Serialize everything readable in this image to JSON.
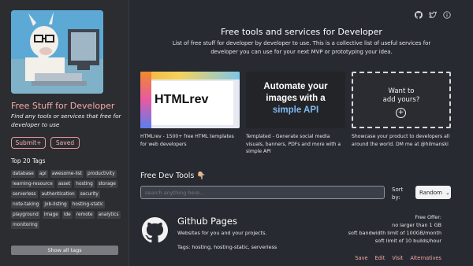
{
  "sidebar": {
    "title": "Free Stuff for Developer",
    "description": "Find any tools or services that free for developer to use",
    "submit_label": "Submit+",
    "saved_label": "Saved",
    "tags_heading": "Top 20 Tags",
    "tags": [
      "database",
      "api",
      "awesome-list",
      "productivity",
      "learning-resource",
      "asset",
      "hosting",
      "storage",
      "serverless",
      "authentication",
      "security",
      "note-taking",
      "job-listing",
      "hosting-static",
      "playground",
      "image",
      "ide",
      "remote",
      "analytics",
      "monitoring"
    ],
    "show_all_label": "Show all tags"
  },
  "header": {
    "icons": [
      "github-icon",
      "twitter-icon",
      "info-icon"
    ],
    "headline": "Free tools and services for Developer",
    "subline": "List of free stuff for developer by developer to use. This is a collective list of useful services for developer you can use for your next MVP or prototyping your idea."
  },
  "featured": [
    {
      "image_text": "HTMLrev",
      "text": "HTMLrev - 1500+ free HTML templates for web developers"
    },
    {
      "image_lines": [
        "Automate your",
        "images with a",
        "simple API"
      ],
      "text": "Templated - Generate social media visuals, banners, PDFs and more with a simple API"
    },
    {
      "image_lines": [
        "Want to",
        "add yours?"
      ],
      "plus": "+",
      "text": "Showcase your product to developers all around the world. DM me at @hilmanski"
    }
  ],
  "tools": {
    "title": "Free Dev Tools 👇🏼",
    "search_placeholder": "search anything here...",
    "sort_label": "Sort by:",
    "sort_value": "Random",
    "sort_caret": "⌄"
  },
  "listing": {
    "title": "Github Pages",
    "description": "Websites for you and your projects.",
    "tags": "Tags: hosting, hosting-static, serverless",
    "offer_lines": [
      "Free Offer:",
      "no larger than 1 GB",
      "soft bandwidth limit of 100GB/month",
      "soft limit of 10 builds/hour"
    ],
    "actions": [
      "Save",
      "Edit",
      "Visit",
      "Alternatives"
    ]
  },
  "colors": {
    "accent": "#f4a9a8",
    "background": "#272a30",
    "sidebar": "#2c2d31"
  }
}
